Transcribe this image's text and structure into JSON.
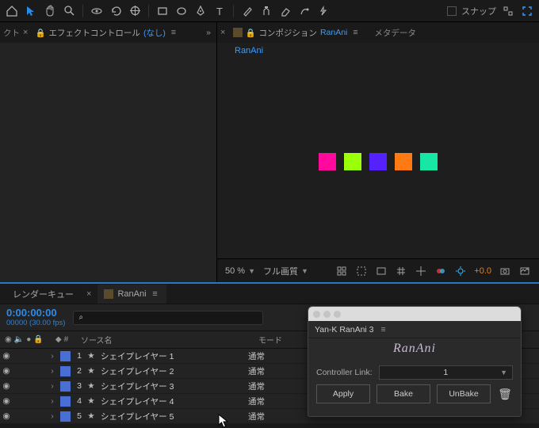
{
  "toolbar": {
    "snap_label": "スナップ"
  },
  "panels": {
    "effect_controls": {
      "title_prefix": "エフェクトコントロール",
      "title_suffix": "(なし)"
    },
    "composition": {
      "title_prefix": "コンポジション",
      "comp_name": "RanAni",
      "metadata_tab": "メタデータ",
      "sub_tab": "RanAni"
    }
  },
  "viewer": {
    "squares": [
      "#ff0a9c",
      "#9cff0a",
      "#5522ff",
      "#ff7a12",
      "#17e6a5"
    ],
    "zoom": "50 %",
    "quality": "フル画質",
    "exposure": "+0.0"
  },
  "timeline": {
    "tabs": {
      "render_queue": "レンダーキュー",
      "comp": "RanAni"
    },
    "timecode": "0:00:00:00",
    "timecode_sub": "00000 (30.00 fps)",
    "search_placeholder": "",
    "columns": {
      "source": "ソース名",
      "mode": "モード",
      "hash": "#"
    },
    "layers": [
      {
        "num": "1",
        "name": "シェイプレイヤー 1",
        "mode": "通常"
      },
      {
        "num": "2",
        "name": "シェイプレイヤー 2",
        "mode": "通常"
      },
      {
        "num": "3",
        "name": "シェイプレイヤー 3",
        "mode": "通常"
      },
      {
        "num": "4",
        "name": "シェイプレイヤー 4",
        "mode": "通常"
      },
      {
        "num": "5",
        "name": "シェイプレイヤー 5",
        "mode": "通常"
      }
    ]
  },
  "plugin_panel": {
    "title": "Yan-K RanAni 3",
    "logo": "RanAni",
    "controller_link_label": "Controller Link:",
    "controller_link_value": "1",
    "buttons": {
      "apply": "Apply",
      "bake": "Bake",
      "unbake": "UnBake"
    }
  }
}
